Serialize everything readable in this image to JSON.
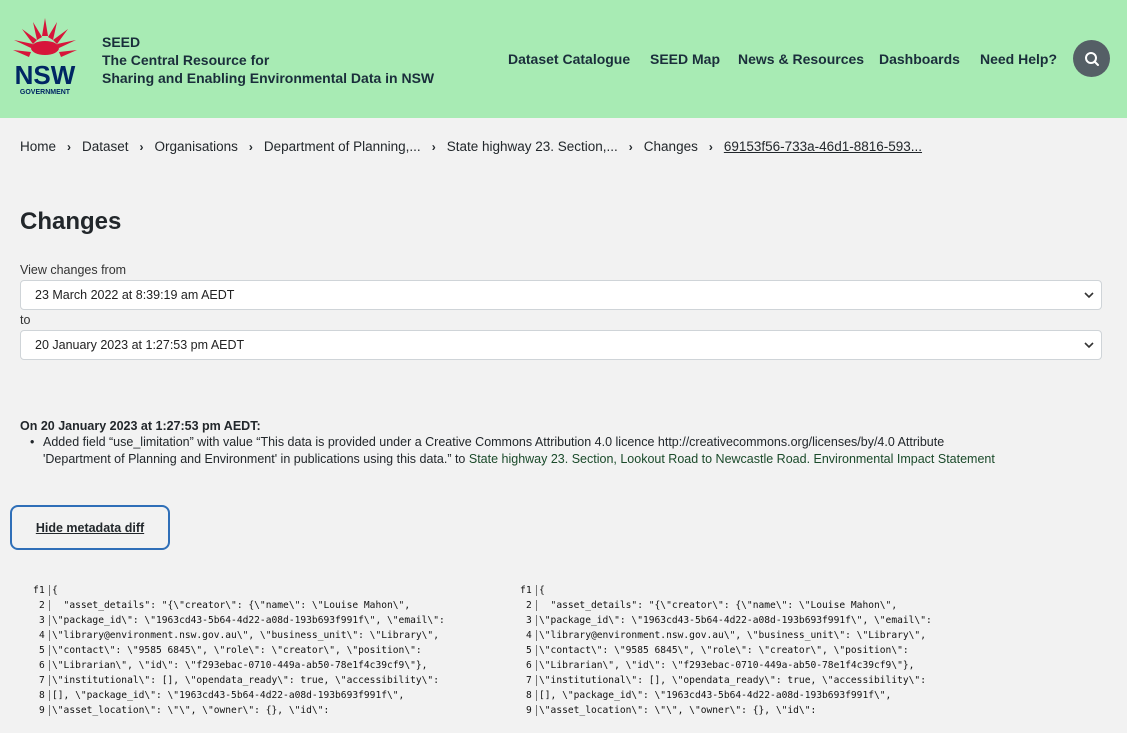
{
  "header": {
    "brand_line1": "SEED",
    "brand_line2": "The Central Resource for",
    "brand_line3": "Sharing and Enabling Environmental Data in NSW",
    "logo_text": "NSW",
    "logo_subtext": "GOVERNMENT",
    "nav": [
      "Dataset Catalogue",
      "SEED Map",
      "News & Resources",
      "Dashboards",
      "Need Help?"
    ],
    "search_icon": "search-icon",
    "bg_color": "#a8ebb4"
  },
  "breadcrumb": [
    "Home",
    "Dataset",
    "Organisations",
    "Department of Planning,...",
    "State highway 23. Section,...",
    "Changes",
    "69153f56-733a-46d1-8816-593..."
  ],
  "main": {
    "title": "Changes",
    "from_label": "View changes from",
    "from_value": "23 March 2022 at 8:39:19 am AEDT",
    "to_label": "to",
    "to_value": "20 January 2023 at 1:27:53 pm AEDT",
    "change_heading": "On 20 January 2023 at 1:27:53 pm AEDT:",
    "change_text_line1": "Added field “use_limitation” with value “This data is provided under a Creative Commons Attribution 4.0 licence http://creativecommons.org/licenses/by/4.0 Attribute",
    "change_text_line2": "'Department of Planning and Environment' in publications using this data.” to ",
    "change_link": "State highway 23. Section, Lookout Road to Newcastle Road. Environmental Impact Statement",
    "hide_button": "Hide metadata diff"
  },
  "diff": {
    "marker": "f",
    "lines": [
      {
        "n": "1",
        "code": "{"
      },
      {
        "n": "2",
        "code": "  \"asset_details\": \"{\\\"creator\\\": {\\\"name\\\": \\\"Louise Mahon\\\","
      },
      {
        "n": "3",
        "code": "\\\"package_id\\\": \\\"1963cd43-5b64-4d22-a08d-193b693f991f\\\", \\\"email\\\":"
      },
      {
        "n": "4",
        "code": "\\\"library@environment.nsw.gov.au\\\", \\\"business_unit\\\": \\\"Library\\\","
      },
      {
        "n": "5",
        "code": "\\\"contact\\\": \\\"9585 6845\\\", \\\"role\\\": \\\"creator\\\", \\\"position\\\":"
      },
      {
        "n": "6",
        "code": "\\\"Librarian\\\", \\\"id\\\": \\\"f293ebac-0710-449a-ab50-78e1f4c39cf9\\\"},"
      },
      {
        "n": "7",
        "code": "\\\"institutional\\\": [], \\\"opendata_ready\\\": true, \\\"accessibility\\\":"
      },
      {
        "n": "8",
        "code": "[], \\\"package_id\\\": \\\"1963cd43-5b64-4d22-a08d-193b693f991f\\\","
      },
      {
        "n": "9",
        "code": "\\\"asset_location\\\": \\\"\\\", \\\"owner\\\": {}, \\\"id\\\":"
      }
    ]
  }
}
